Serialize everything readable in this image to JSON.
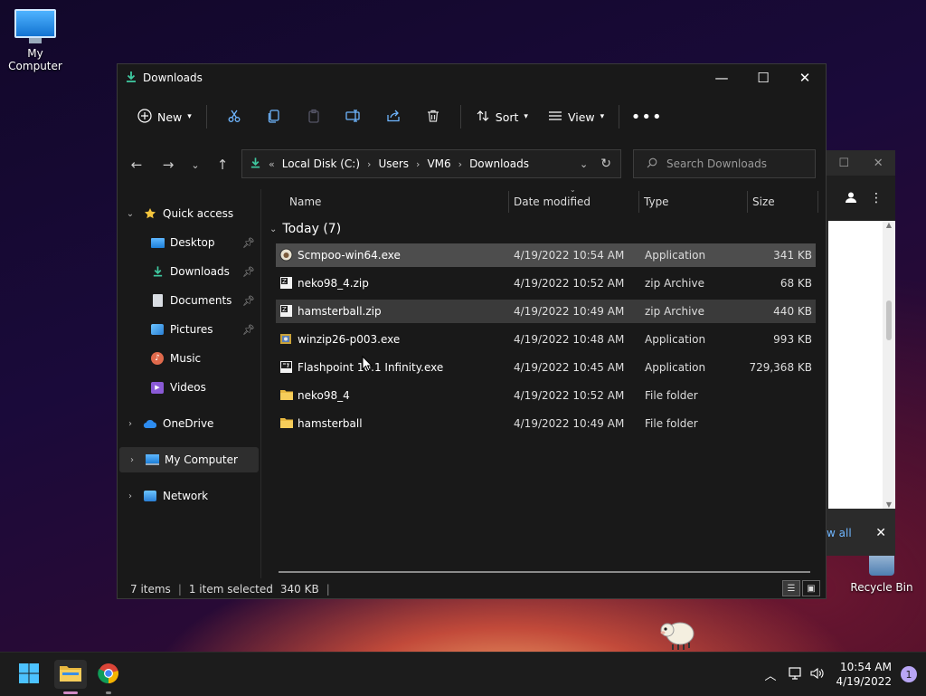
{
  "desktop": {
    "icons": [
      {
        "label": "My Computer"
      },
      {
        "label": "Recycle Bin"
      }
    ]
  },
  "background_window": {
    "view_all_label": "w all"
  },
  "window": {
    "title": "Downloads",
    "toolbar": {
      "new_label": "New",
      "sort_label": "Sort",
      "view_label": "View"
    },
    "address": {
      "prefix": "«",
      "crumbs": [
        "Local Disk (C:)",
        "Users",
        "VM6",
        "Downloads"
      ]
    },
    "search": {
      "placeholder": "Search Downloads"
    },
    "sidebar": {
      "quick_access": "Quick access",
      "items": [
        {
          "label": "Desktop",
          "pinned": true
        },
        {
          "label": "Downloads",
          "pinned": true
        },
        {
          "label": "Documents",
          "pinned": true
        },
        {
          "label": "Pictures",
          "pinned": true
        },
        {
          "label": "Music",
          "pinned": false
        },
        {
          "label": "Videos",
          "pinned": false
        }
      ],
      "onedrive": "OneDrive",
      "my_computer": "My Computer",
      "network": "Network"
    },
    "columns": [
      "Name",
      "Date modified",
      "Type",
      "Size"
    ],
    "group_label": "Today (7)",
    "files": [
      {
        "name": "Scmpoo-win64.exe",
        "date": "4/19/2022 10:54 AM",
        "type": "Application",
        "size": "341 KB",
        "icon": "sheep-app-icon"
      },
      {
        "name": "neko98_4.zip",
        "date": "4/19/2022 10:52 AM",
        "type": "zip Archive",
        "size": "68 KB",
        "icon": "zip-icon"
      },
      {
        "name": "hamsterball.zip",
        "date": "4/19/2022 10:49 AM",
        "type": "zip Archive",
        "size": "440 KB",
        "icon": "zip-icon"
      },
      {
        "name": "winzip26-p003.exe",
        "date": "4/19/2022 10:48 AM",
        "type": "Application",
        "size": "993 KB",
        "icon": "winzip-icon"
      },
      {
        "name": "Flashpoint 10.1 Infinity.exe",
        "date": "4/19/2022 10:45 AM",
        "type": "Application",
        "size": "729,368 KB",
        "icon": "flashpoint-icon"
      },
      {
        "name": "neko98_4",
        "date": "4/19/2022 10:52 AM",
        "type": "File folder",
        "size": "",
        "icon": "folder-icon"
      },
      {
        "name": "hamsterball",
        "date": "4/19/2022 10:49 AM",
        "type": "File folder",
        "size": "",
        "icon": "folder-icon"
      }
    ],
    "status": {
      "items": "7 items",
      "selected": "1 item selected",
      "selected_size": "340 KB"
    }
  },
  "taskbar": {
    "time": "10:54 AM",
    "date": "4/19/2022",
    "notifications": "1"
  }
}
